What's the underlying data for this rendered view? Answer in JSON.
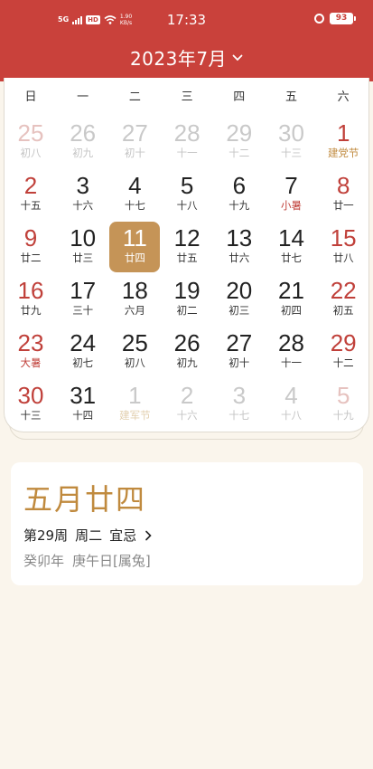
{
  "status_bar": {
    "network": "5G",
    "hd": "HD",
    "speed_value": "1.90",
    "speed_unit": "KB/s",
    "time": "17:33",
    "battery": "93"
  },
  "header": {
    "month_title": "2023年7月"
  },
  "weekdays": [
    "日",
    "一",
    "二",
    "三",
    "四",
    "五",
    "六"
  ],
  "days": [
    {
      "num": "25",
      "lunar": "初八",
      "other": true
    },
    {
      "num": "26",
      "lunar": "初九",
      "other": true
    },
    {
      "num": "27",
      "lunar": "初十",
      "other": true
    },
    {
      "num": "28",
      "lunar": "十一",
      "other": true
    },
    {
      "num": "29",
      "lunar": "十二",
      "other": true
    },
    {
      "num": "30",
      "lunar": "十三",
      "other": true
    },
    {
      "num": "1",
      "lunar": "建党节",
      "festival": true
    },
    {
      "num": "2",
      "lunar": "十五"
    },
    {
      "num": "3",
      "lunar": "十六"
    },
    {
      "num": "4",
      "lunar": "十七"
    },
    {
      "num": "5",
      "lunar": "十八"
    },
    {
      "num": "6",
      "lunar": "十九"
    },
    {
      "num": "7",
      "lunar": "小暑",
      "term": true
    },
    {
      "num": "8",
      "lunar": "廿一"
    },
    {
      "num": "9",
      "lunar": "廿二"
    },
    {
      "num": "10",
      "lunar": "廿三"
    },
    {
      "num": "11",
      "lunar": "廿四",
      "selected": true
    },
    {
      "num": "12",
      "lunar": "廿五"
    },
    {
      "num": "13",
      "lunar": "廿六"
    },
    {
      "num": "14",
      "lunar": "廿七"
    },
    {
      "num": "15",
      "lunar": "廿八"
    },
    {
      "num": "16",
      "lunar": "廿九"
    },
    {
      "num": "17",
      "lunar": "三十"
    },
    {
      "num": "18",
      "lunar": "六月"
    },
    {
      "num": "19",
      "lunar": "初二"
    },
    {
      "num": "20",
      "lunar": "初三"
    },
    {
      "num": "21",
      "lunar": "初四"
    },
    {
      "num": "22",
      "lunar": "初五"
    },
    {
      "num": "23",
      "lunar": "大暑",
      "term": true
    },
    {
      "num": "24",
      "lunar": "初七"
    },
    {
      "num": "25",
      "lunar": "初八"
    },
    {
      "num": "26",
      "lunar": "初九"
    },
    {
      "num": "27",
      "lunar": "初十"
    },
    {
      "num": "28",
      "lunar": "十一"
    },
    {
      "num": "29",
      "lunar": "十二"
    },
    {
      "num": "30",
      "lunar": "十三"
    },
    {
      "num": "31",
      "lunar": "十四"
    },
    {
      "num": "1",
      "lunar": "建军节",
      "other": true,
      "festival": true
    },
    {
      "num": "2",
      "lunar": "十六",
      "other": true
    },
    {
      "num": "3",
      "lunar": "十七",
      "other": true
    },
    {
      "num": "4",
      "lunar": "十八",
      "other": true
    },
    {
      "num": "5",
      "lunar": "十九",
      "other": true
    }
  ],
  "info": {
    "lunar_date": "五月廿四",
    "week": "第29周",
    "weekday": "周二",
    "yiji": "宜忌",
    "ganzhi_year": "癸卯年",
    "ganzhi_day": "庚午日[属兔]"
  },
  "colors": {
    "header_red": "#c9413b",
    "weekend_red": "#c0403a",
    "gold": "#c08a3e",
    "selected_bg": "#c59457"
  }
}
